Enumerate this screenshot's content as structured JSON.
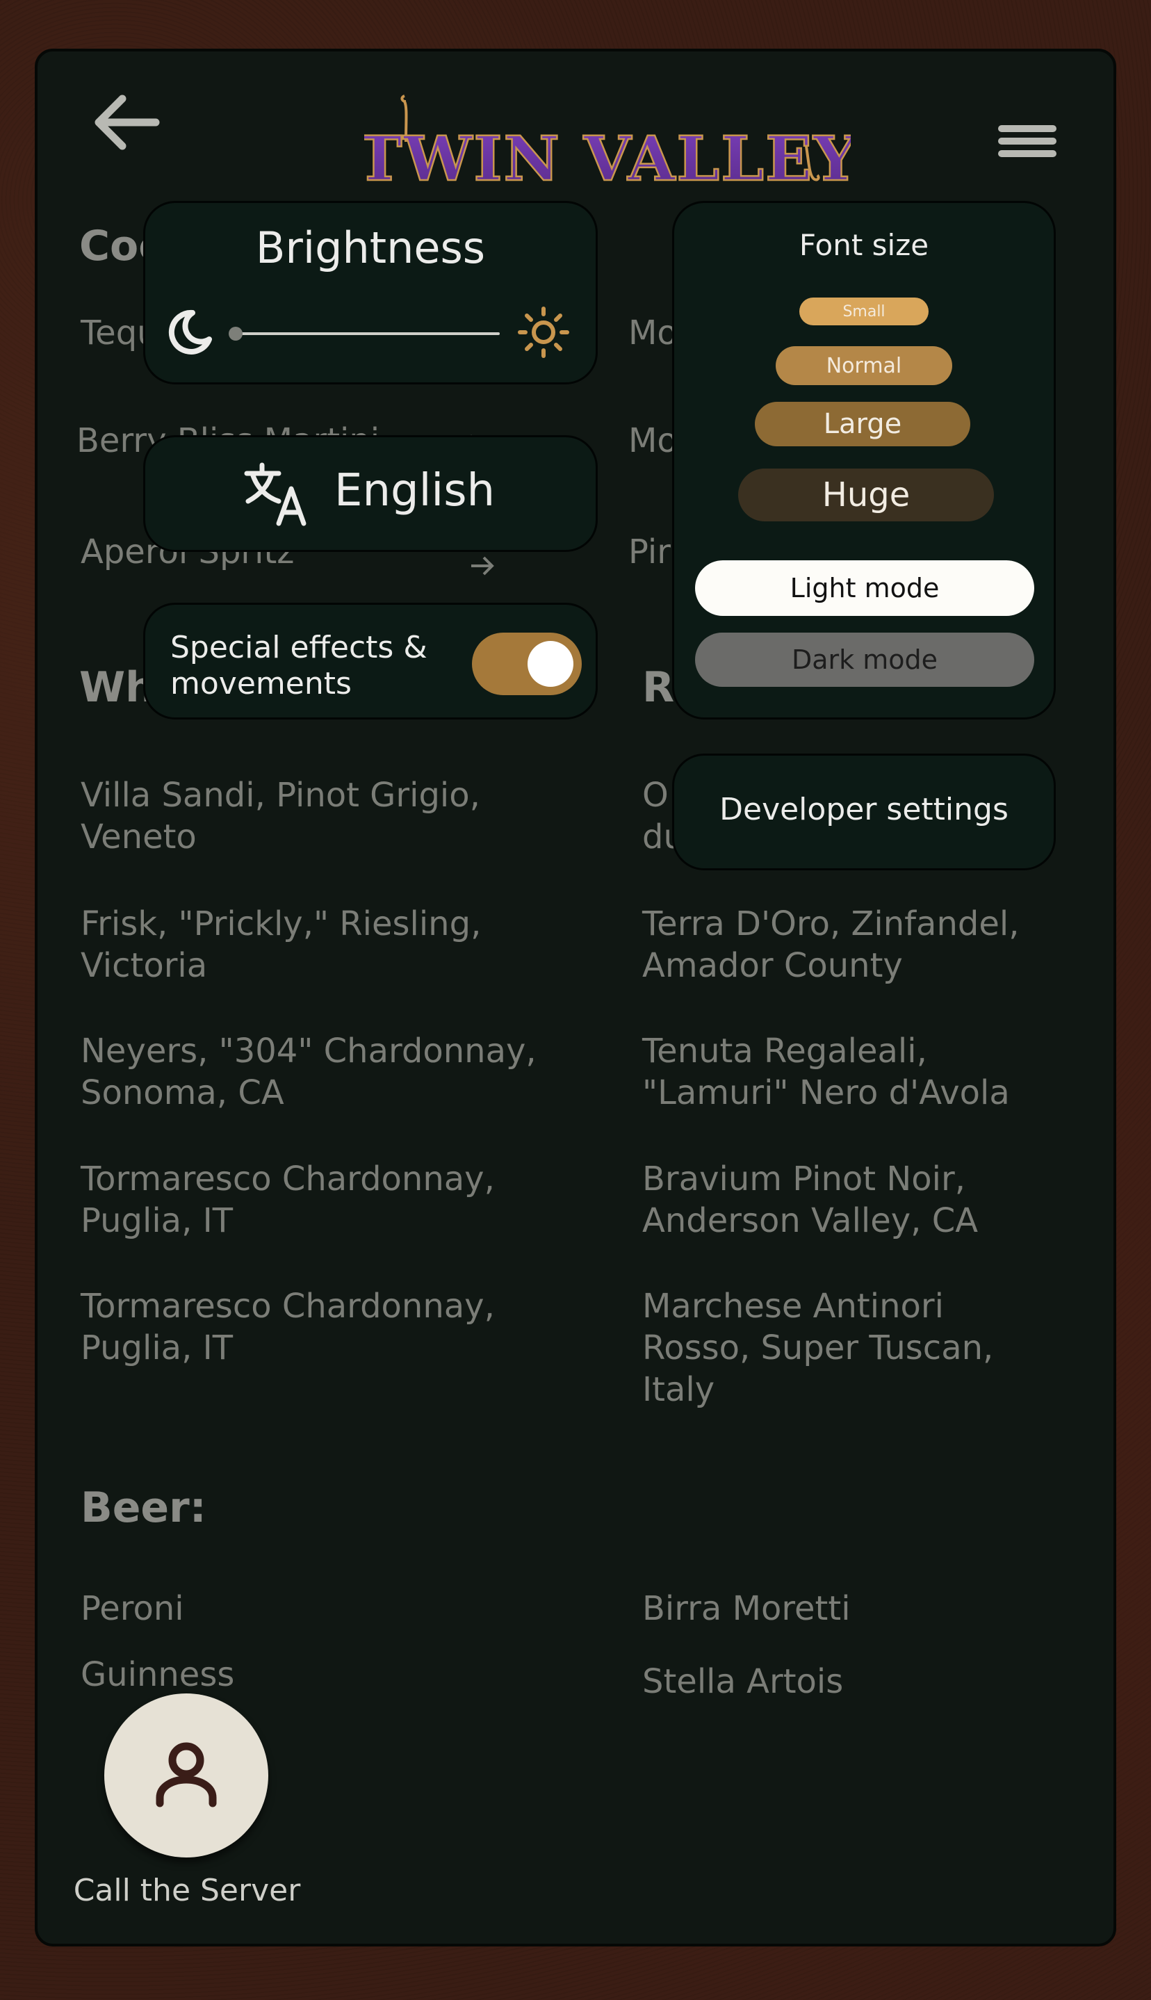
{
  "header": {
    "title": "TWIN VALLEY",
    "back_icon": "arrow-left-icon",
    "menu_icon": "hamburger-menu-icon"
  },
  "menu": {
    "cocktails": {
      "heading_partial": "Coc",
      "items_left": [
        "Tequ",
        "Berry Bliss Martini",
        "Aperol Spritz"
      ],
      "items_right": [
        "Mo",
        "Mo",
        "Pir"
      ]
    },
    "white": {
      "heading_partial": "Wh",
      "items": [
        "Villa Sandi, Pinot Grigio, Veneto",
        "Frisk, \"Prickly,\" Riesling, Victoria",
        "Neyers, \"304\" Chardonnay, Sonoma, CA",
        "Tormaresco Chardonnay, Puglia, IT",
        "Tormaresco Chardonnay, Puglia, IT"
      ]
    },
    "red": {
      "heading_partial": "R",
      "items": [
        "O du",
        "Terra D'Oro, Zinfandel, Amador County",
        "Tenuta Regaleali, \"Lamuri\" Nero d'Avola",
        "Bravium Pinot Noir, Anderson Valley, CA",
        "Marchese Antinori Rosso, Super Tuscan, Italy"
      ]
    },
    "beer": {
      "heading": "Beer:",
      "items_left": [
        "Peroni",
        "Guinness"
      ],
      "items_right": [
        "Birra Moretti",
        "Stella Artois"
      ]
    }
  },
  "settings": {
    "brightness": {
      "label": "Brightness",
      "level": 0,
      "icon_low": "moon-icon",
      "icon_high": "sun-icon"
    },
    "language": {
      "label": "English",
      "icon": "translate-icon"
    },
    "effects": {
      "label_line1": "Special effects &",
      "label_line2": "movements",
      "enabled": true
    },
    "font_size": {
      "label": "Font size",
      "options": [
        "Small",
        "Normal",
        "Large",
        "Huge"
      ],
      "selected": "Huge"
    },
    "theme": {
      "light": "Light mode",
      "dark": "Dark mode"
    },
    "developer": "Developer settings"
  },
  "call_server": {
    "label": "Call the Server",
    "icon": "person-icon"
  },
  "colors": {
    "accent": "#c9964e",
    "panel": "#0c1a15",
    "background": "#101713"
  }
}
